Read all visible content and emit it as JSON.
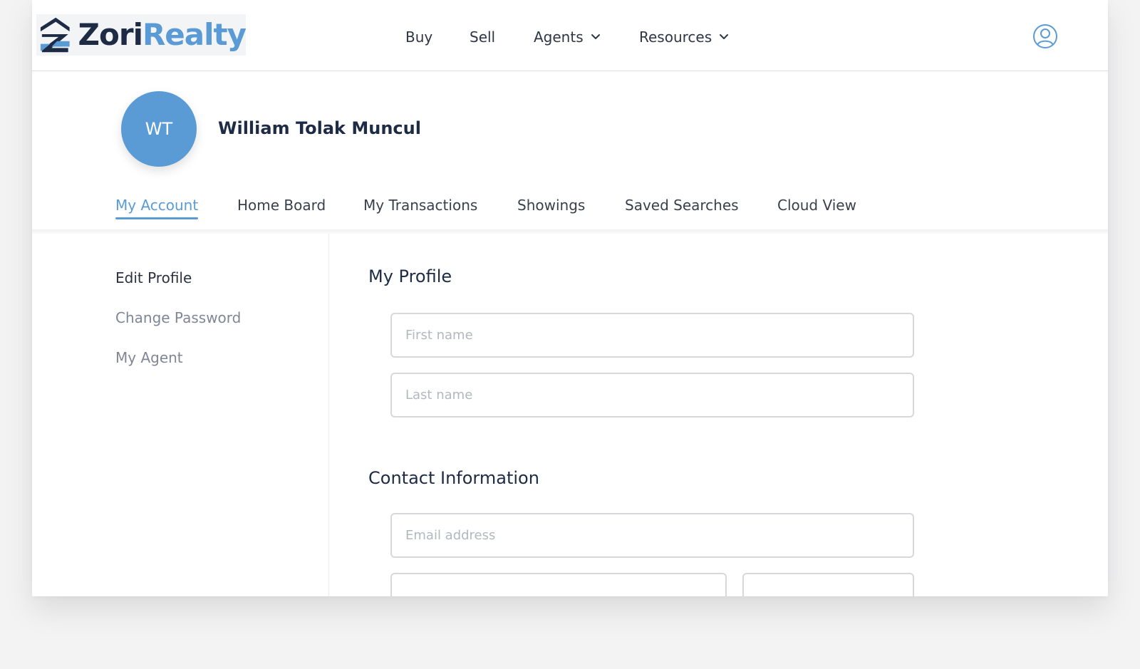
{
  "brand": {
    "name_part1": "Zori",
    "name_part2": "Realty",
    "colors": {
      "dark": "#1d2b45",
      "accent": "#5b9bd5"
    }
  },
  "nav": {
    "items": [
      {
        "label": "Buy",
        "has_dropdown": false
      },
      {
        "label": "Sell",
        "has_dropdown": false
      },
      {
        "label": "Agents",
        "has_dropdown": true
      },
      {
        "label": "Resources",
        "has_dropdown": true
      }
    ],
    "user_icon": "user-circle-icon"
  },
  "profile": {
    "initials": "WT",
    "full_name": "William Tolak Muncul"
  },
  "tabs": [
    {
      "label": "My Account",
      "active": true
    },
    {
      "label": "Home Board",
      "active": false
    },
    {
      "label": "My Transactions",
      "active": false
    },
    {
      "label": "Showings",
      "active": false
    },
    {
      "label": "Saved Searches",
      "active": false
    },
    {
      "label": "Cloud View",
      "active": false
    }
  ],
  "sidebar": {
    "items": [
      {
        "label": "Edit Profile",
        "active": true
      },
      {
        "label": "Change Password",
        "active": false
      },
      {
        "label": "My Agent",
        "active": false
      }
    ]
  },
  "form": {
    "profile_section": {
      "title": "My Profile",
      "first_name": {
        "value": "",
        "placeholder": "First name"
      },
      "last_name": {
        "value": "",
        "placeholder": "Last name"
      }
    },
    "contact_section": {
      "title": "Contact Information",
      "email": {
        "value": "",
        "placeholder": "Email address"
      },
      "field_a": {
        "value": "",
        "placeholder": ""
      },
      "field_b": {
        "value": "",
        "placeholder": ""
      }
    }
  }
}
